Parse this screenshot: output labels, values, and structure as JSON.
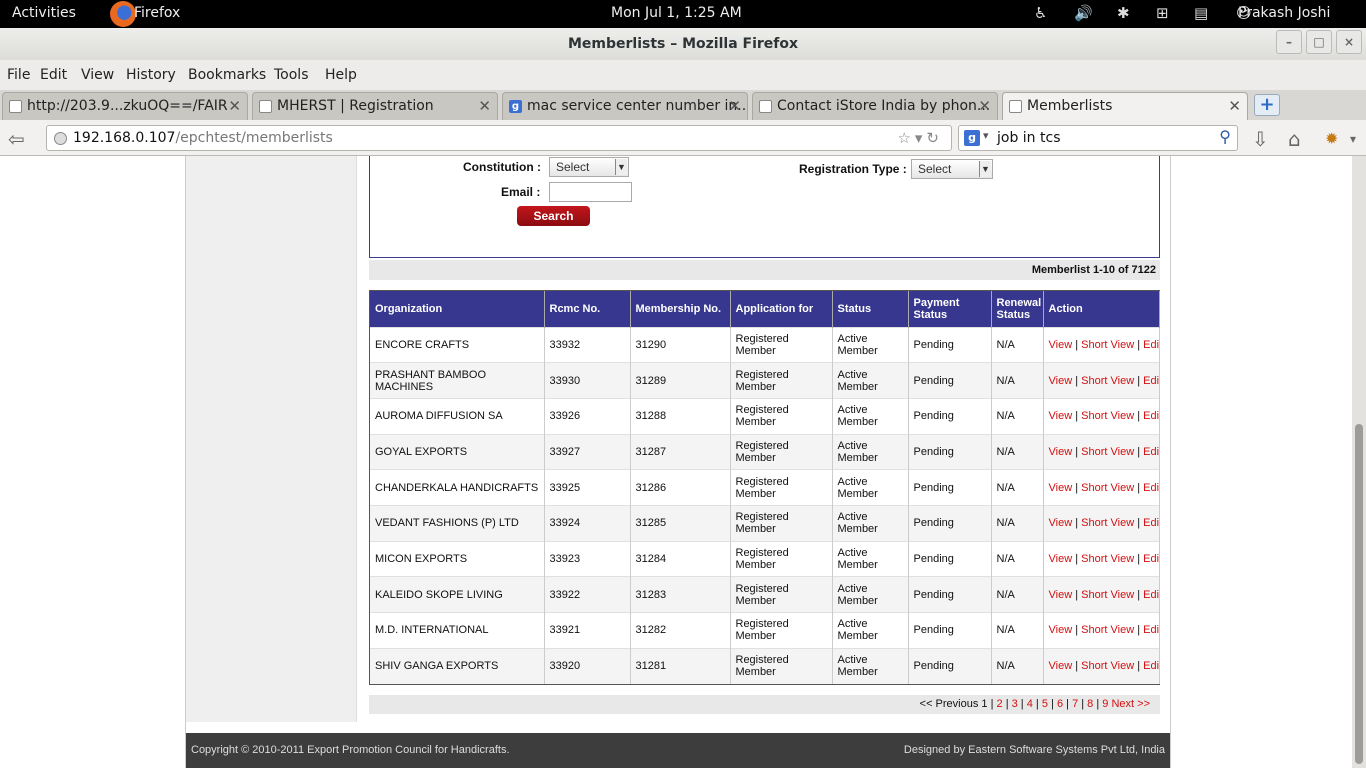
{
  "topbar": {
    "activities": "Activities",
    "app_name": "Firefox",
    "clock": "Mon Jul  1,  1:25 AM",
    "user": "Prakash Joshi"
  },
  "window": {
    "title": "Memberlists – Mozilla Firefox",
    "minimize": "–",
    "maximize": "□",
    "close": "×"
  },
  "menu": [
    "File",
    "Edit",
    "View",
    "History",
    "Bookmarks",
    "Tools",
    "Help"
  ],
  "tabs": [
    {
      "label": "http://203.9...zkuOQ==/FAIR",
      "active": false
    },
    {
      "label": "MHERST | Registration",
      "active": false
    },
    {
      "label": "mac service center number in...",
      "active": false
    },
    {
      "label": "Contact iStore India by phon...",
      "active": false
    },
    {
      "label": "Memberlists",
      "active": true
    }
  ],
  "nav": {
    "url_host": "192.168.0.107",
    "url_path": "/epchtest/memberlists",
    "search_value": "job in tcs"
  },
  "search_form": {
    "constitution_label": "Constitution :",
    "constitution_value": "Select",
    "email_label": "Email :",
    "email_value": "",
    "registration_type_label": "Registration Type :",
    "registration_type_value": "Select",
    "search_button": "Search"
  },
  "results": {
    "summary": "Memberlist 1-10 of 7122",
    "columns": [
      "Organization",
      "Rcmc No.",
      "Membership No.",
      "Application for",
      "Status",
      "Payment Status",
      "Renewal Status",
      "Action"
    ],
    "rows": [
      {
        "org": "ENCORE CRAFTS",
        "rcmc": "33932",
        "membership": "31290",
        "application": "Registered Member",
        "status": "Active Member",
        "payment": "Pending",
        "renewal": "N/A"
      },
      {
        "org": "PRASHANT BAMBOO MACHINES",
        "rcmc": "33930",
        "membership": "31289",
        "application": "Registered Member",
        "status": "Active Member",
        "payment": "Pending",
        "renewal": "N/A"
      },
      {
        "org": "AUROMA DIFFUSION SA",
        "rcmc": "33926",
        "membership": "31288",
        "application": "Registered Member",
        "status": "Active Member",
        "payment": "Pending",
        "renewal": "N/A"
      },
      {
        "org": "GOYAL EXPORTS",
        "rcmc": "33927",
        "membership": "31287",
        "application": "Registered Member",
        "status": "Active Member",
        "payment": "Pending",
        "renewal": "N/A"
      },
      {
        "org": "CHANDERKALA HANDICRAFTS",
        "rcmc": "33925",
        "membership": "31286",
        "application": "Registered Member",
        "status": "Active Member",
        "payment": "Pending",
        "renewal": "N/A"
      },
      {
        "org": "VEDANT FASHIONS (P) LTD",
        "rcmc": "33924",
        "membership": "31285",
        "application": "Registered Member",
        "status": "Active Member",
        "payment": "Pending",
        "renewal": "N/A"
      },
      {
        "org": "MICON EXPORTS",
        "rcmc": "33923",
        "membership": "31284",
        "application": "Registered Member",
        "status": "Active Member",
        "payment": "Pending",
        "renewal": "N/A"
      },
      {
        "org": "KALEIDO SKOPE LIVING",
        "rcmc": "33922",
        "membership": "31283",
        "application": "Registered Member",
        "status": "Active Member",
        "payment": "Pending",
        "renewal": "N/A"
      },
      {
        "org": "M.D. INTERNATIONAL",
        "rcmc": "33921",
        "membership": "31282",
        "application": "Registered Member",
        "status": "Active Member",
        "payment": "Pending",
        "renewal": "N/A"
      },
      {
        "org": "SHIV GANGA EXPORTS",
        "rcmc": "33920",
        "membership": "31281",
        "application": "Registered Member",
        "status": "Active Member",
        "payment": "Pending",
        "renewal": "N/A"
      }
    ],
    "actions": [
      "View",
      "Short View",
      "Edit"
    ]
  },
  "pagination": {
    "previous": "<< Previous",
    "current": "1",
    "pages": [
      "2",
      "3",
      "4",
      "5",
      "6",
      "7",
      "8",
      "9"
    ],
    "next": "Next >>"
  },
  "footer": {
    "copyright": "Copyright © 2010-2011 Export Promotion Council for Handicrafts.",
    "designer": "Designed by Eastern Software Systems Pvt Ltd, India"
  },
  "colors": {
    "table_header": "#37378f",
    "link": "#d21010",
    "search_button": "#b01218",
    "footer": "#3d3d3d"
  }
}
